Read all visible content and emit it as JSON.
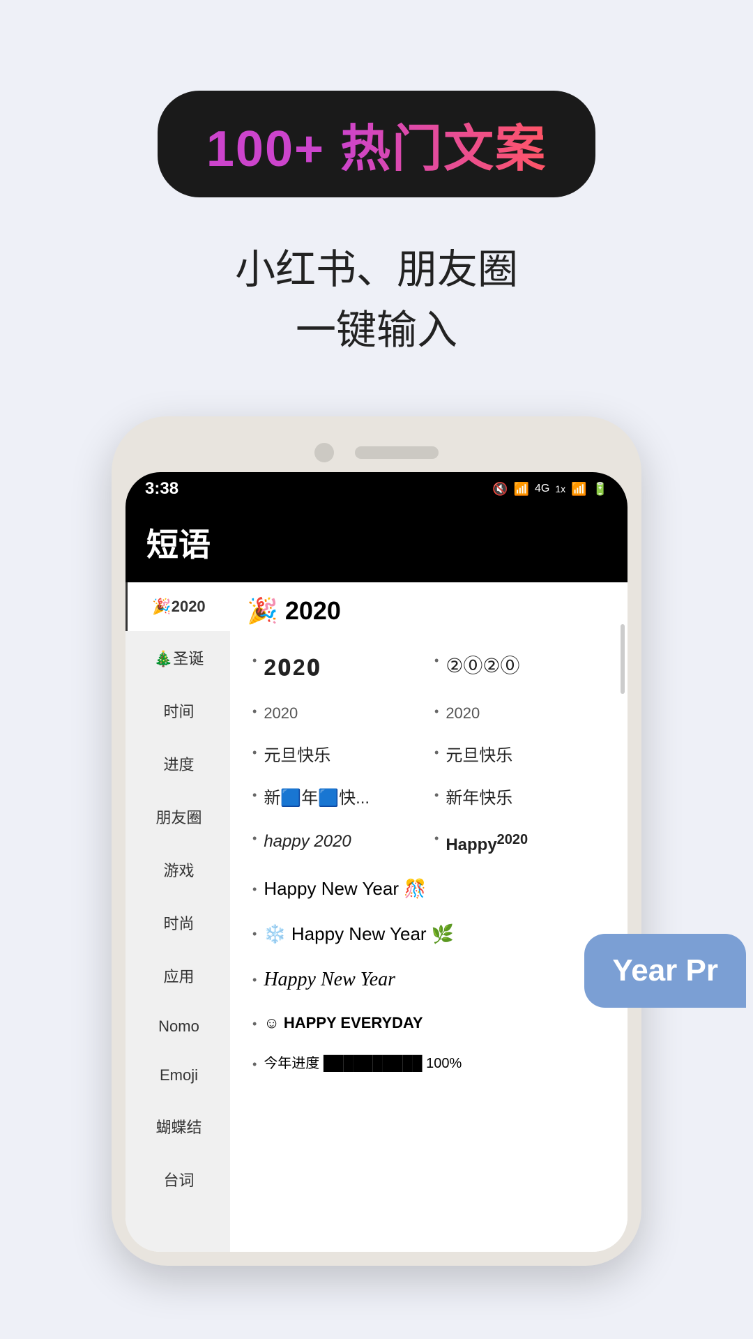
{
  "badge": {
    "number": "100+ ",
    "label": "热门文案"
  },
  "subtitle_line1": "小红书、朋友圈",
  "subtitle_line2": "一键输入",
  "phone": {
    "time": "3:38",
    "status_icons": "🔇 📶 4G 1X 📶 🔋",
    "app_title": "短语",
    "section_emoji": "🎉",
    "section_year": "2020"
  },
  "sidebar_items": [
    {
      "label": "🎉2020",
      "active": true
    },
    {
      "label": "🎄圣诞",
      "active": false
    },
    {
      "label": "时间",
      "active": false
    },
    {
      "label": "进度",
      "active": false
    },
    {
      "label": "朋友圈",
      "active": false
    },
    {
      "label": "游戏",
      "active": false
    },
    {
      "label": "时尚",
      "active": false
    },
    {
      "label": "应用",
      "active": false
    },
    {
      "label": "Nomo",
      "active": false
    },
    {
      "label": "Emoji",
      "active": false
    },
    {
      "label": "蝴蝶结",
      "active": false
    },
    {
      "label": "台词",
      "active": false
    }
  ],
  "content_items": [
    {
      "col": 1,
      "text": "2𝟎2𝟎",
      "style": "styled"
    },
    {
      "col": 2,
      "text": "②⓪②⓪",
      "style": "circled"
    },
    {
      "col": 1,
      "text": "2020",
      "style": "small"
    },
    {
      "col": 2,
      "text": "2020",
      "style": "small"
    },
    {
      "col": 1,
      "text": "元旦快乐",
      "style": "normal"
    },
    {
      "col": 2,
      "text": "元旦快乐",
      "style": "normal"
    },
    {
      "col": 1,
      "text": "新🟦年🟦快...",
      "style": "normal"
    },
    {
      "col": 2,
      "text": "新年快乐",
      "style": "normal"
    },
    {
      "col": 1,
      "text": "happy 2020",
      "style": "italic"
    },
    {
      "col": 2,
      "text": "Happy2020",
      "style": "bold"
    },
    {
      "full": true,
      "text": "Happy New Year 🎊",
      "style": "normal"
    },
    {
      "full": true,
      "text": "❄️ Happy New Year 🌿",
      "style": "normal"
    },
    {
      "full": true,
      "text": "Happy New Year",
      "style": "script"
    },
    {
      "full": true,
      "text": "☺ HAPPY EVERYDAY",
      "style": "caps"
    },
    {
      "full": true,
      "text": "今年进度 ■■■■■■■■■■ 100%",
      "style": "progress"
    }
  ],
  "tooltip": {
    "text": "Year Pr"
  }
}
